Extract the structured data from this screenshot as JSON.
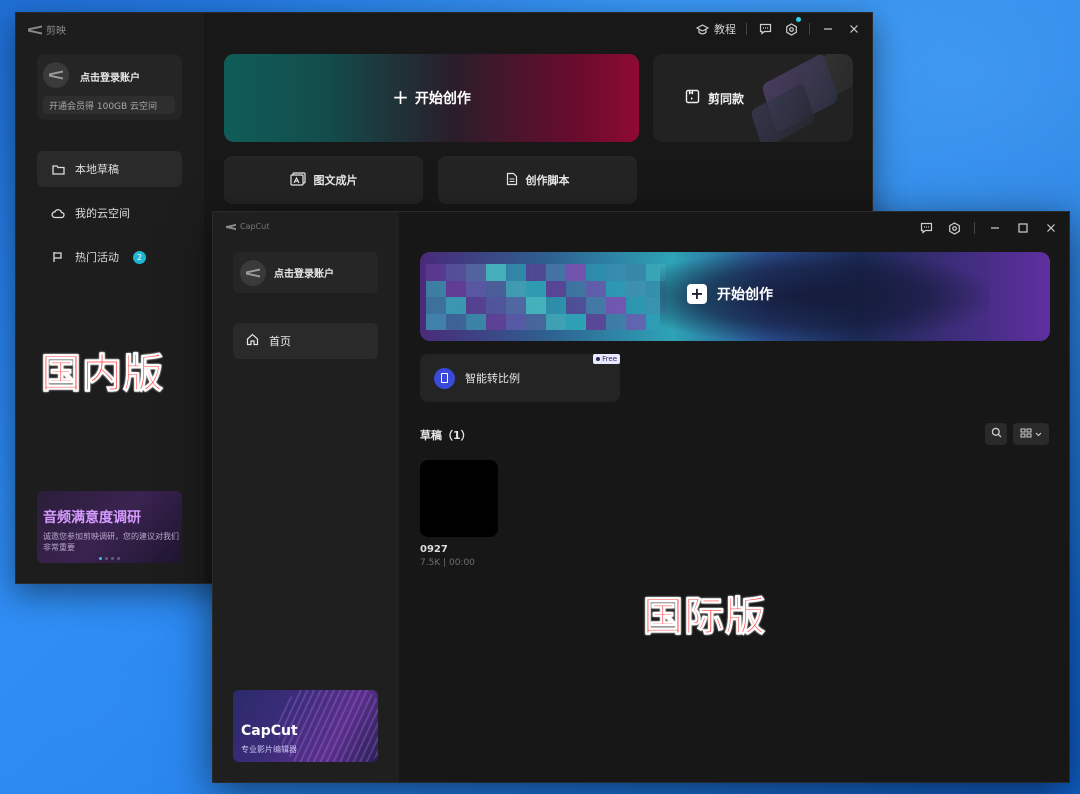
{
  "domestic": {
    "app_name": "剪映",
    "account": {
      "login_label": "点击登录账户",
      "promo_label": "开通会员得 100GB 云空间"
    },
    "nav": [
      {
        "label": "本地草稿",
        "active": true,
        "icon": "folder-icon"
      },
      {
        "label": "我的云空间",
        "active": false,
        "icon": "cloud-icon"
      },
      {
        "label": "热门活动",
        "active": false,
        "icon": "flag-icon",
        "badge": "2"
      }
    ],
    "overlay_label": "国内版",
    "survey": {
      "title": "音频满意度调研",
      "body": "诚邀您参加剪映调研，您的建议对我们非常重要"
    },
    "titlebar": {
      "tutorial_label": "教程"
    },
    "start_label": "开始创作",
    "template_label": "剪同款",
    "actions": [
      {
        "label": "图文成片",
        "icon": "image-text-icon"
      },
      {
        "label": "创作脚本",
        "icon": "script-icon"
      }
    ]
  },
  "international": {
    "app_name": "CapCut",
    "account": {
      "login_label": "点击登录账户"
    },
    "nav": [
      {
        "label": "首页",
        "active": true,
        "icon": "home-icon"
      }
    ],
    "promo": {
      "name": "CapCut",
      "sub": "专业影片编辑器"
    },
    "start_label": "开始创作",
    "ratio_card": {
      "label": "智能转比例",
      "tag": "Free"
    },
    "drafts": {
      "title": "草稿（1）",
      "items": [
        {
          "name": "0927",
          "meta": "7.5K | 00:00"
        }
      ]
    },
    "overlay_label": "国际版"
  },
  "colors": {
    "overlay_text": "#ff2a2a",
    "badge": "#1fb6d6",
    "ratio_icon": "#3b49d8"
  }
}
